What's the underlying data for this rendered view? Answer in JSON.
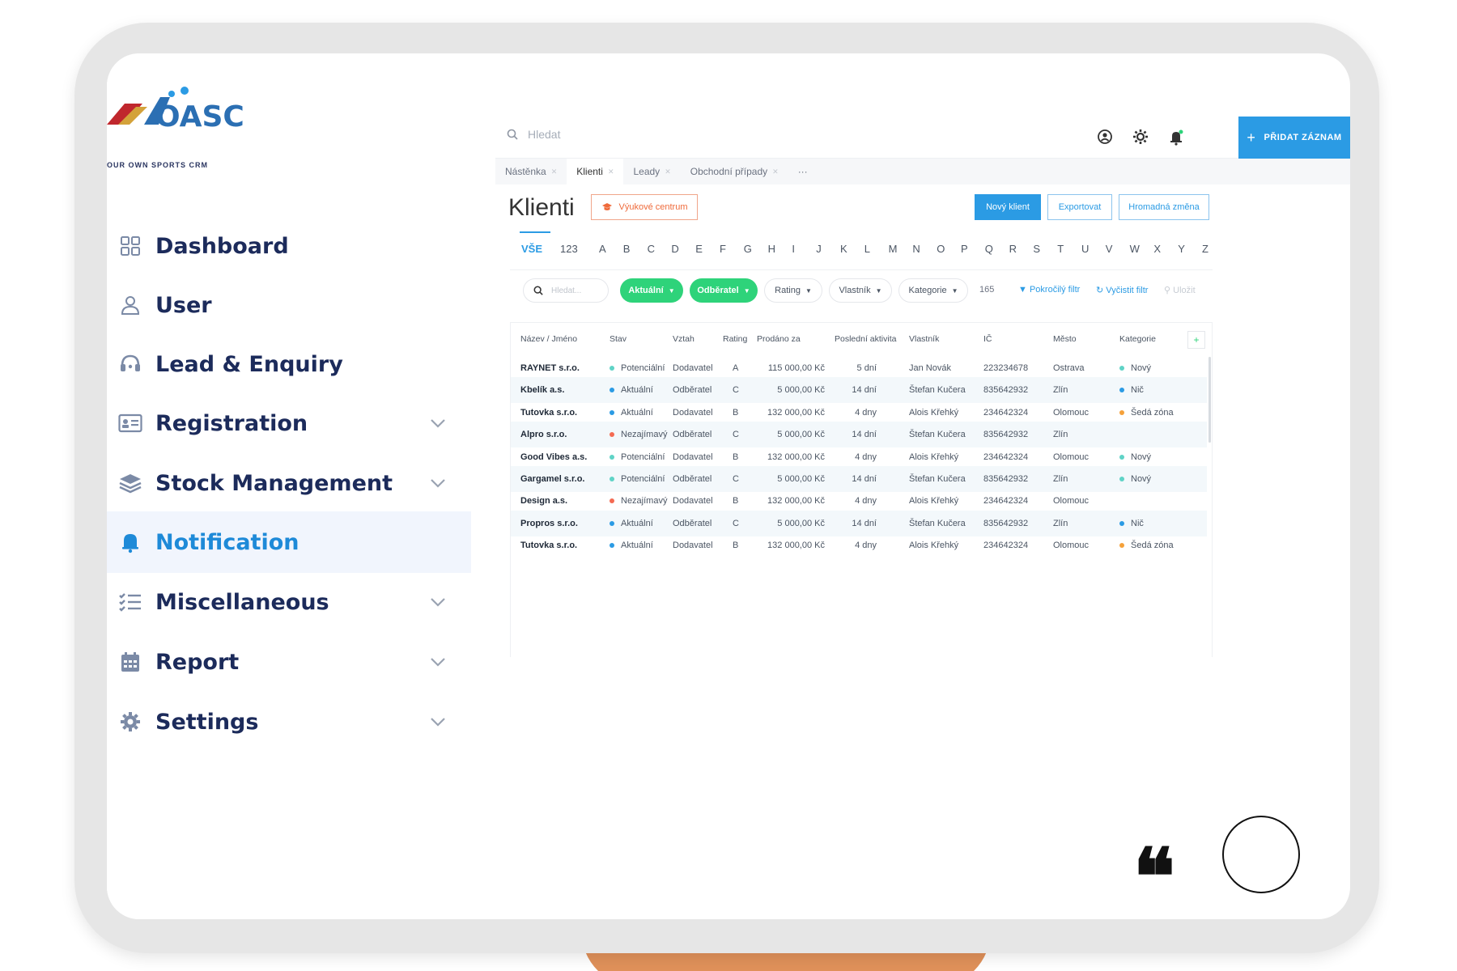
{
  "brand": {
    "logo_text": "OASC",
    "logo_tagline": "OUR OWN SPORTS CRM"
  },
  "sidebar": {
    "items": [
      {
        "label": "Dashboard",
        "icon": "grid-icon",
        "chevron": false,
        "active": false
      },
      {
        "label": "User",
        "icon": "user-icon",
        "chevron": false,
        "active": false
      },
      {
        "label": "Lead & Enquiry",
        "icon": "headset-icon",
        "chevron": false,
        "active": false
      },
      {
        "label": "Registration",
        "icon": "id-card-icon",
        "chevron": true,
        "active": false
      },
      {
        "label": "Stock Management",
        "icon": "layers-icon",
        "chevron": true,
        "active": false
      },
      {
        "label": "Notification",
        "icon": "bell-icon",
        "chevron": false,
        "active": true
      },
      {
        "label": "Miscellaneous",
        "icon": "checklist-icon",
        "chevron": true,
        "active": false
      },
      {
        "label": "Report",
        "icon": "calendar-icon",
        "chevron": true,
        "active": false
      },
      {
        "label": "Settings",
        "icon": "gear-icon",
        "chevron": true,
        "active": false
      }
    ]
  },
  "topbar": {
    "search_placeholder": "Hledat",
    "add_button": "PŘIDAT ZÁZNAM"
  },
  "tabs": [
    {
      "label": "Nástěnka",
      "active": false
    },
    {
      "label": "Klienti",
      "active": true
    },
    {
      "label": "Leady",
      "active": false
    },
    {
      "label": "Obchodní případy",
      "active": false
    }
  ],
  "tabs_more": "···",
  "page": {
    "title": "Klienti",
    "training_button": "Výukové centrum",
    "new_client_button": "Nový klient",
    "export_button": "Exportovat",
    "bulk_button": "Hromadná změna"
  },
  "alphabet": [
    "VŠE",
    "123",
    "A",
    "B",
    "C",
    "D",
    "E",
    "F",
    "G",
    "H",
    "I",
    "J",
    "K",
    "L",
    "M",
    "N",
    "O",
    "P",
    "Q",
    "R",
    "S",
    "T",
    "U",
    "V",
    "W",
    "X",
    "Y",
    "Z"
  ],
  "filters": {
    "search_placeholder": "Hledat...",
    "status_pill": "Aktuální",
    "relation_pill": "Odběratel",
    "rating": "Rating",
    "owner": "Vlastník",
    "category": "Kategorie",
    "count": "165",
    "advanced": "Pokročilý filtr",
    "clear": "Vyčistit filtr",
    "saved": "Uložit"
  },
  "table": {
    "columns": [
      "Název / Jméno",
      "Stav",
      "Vztah",
      "Rating",
      "Prodáno za",
      "Poslední aktivita",
      "Vlastník",
      "IČ",
      "Město",
      "Kategorie"
    ],
    "rows": [
      {
        "name": "RAYNET s.r.o.",
        "status": "Potenciální",
        "status_color": "#5fd3c6",
        "relation": "Dodavatel",
        "rating": "A",
        "sold": "115 000,00 Kč",
        "last": "5 dní",
        "owner": "Jan Novák",
        "ic": "223234678",
        "city": "Ostrava",
        "category": "Nový",
        "cat_color": "#5fd3c6"
      },
      {
        "name": "Kbelík a.s.",
        "status": "Aktuální",
        "status_color": "#2b9be4",
        "relation": "Odběratel",
        "rating": "C",
        "sold": "5 000,00 Kč",
        "last": "14 dní",
        "owner": "Štefan Kučera",
        "ic": "835642932",
        "city": "Zlín",
        "category": "Nič",
        "cat_color": "#2b9be4"
      },
      {
        "name": "Tutovka s.r.o.",
        "status": "Aktuální",
        "status_color": "#2b9be4",
        "relation": "Dodavatel",
        "rating": "B",
        "sold": "132 000,00 Kč",
        "last": "4 dny",
        "owner": "Alois Křehký",
        "ic": "234642324",
        "city": "Olomouc",
        "category": "Šedá zóna",
        "cat_color": "#f5a13a"
      },
      {
        "name": "Alpro s.r.o.",
        "status": "Nezajímavý",
        "status_color": "#f46a52",
        "relation": "Odběratel",
        "rating": "C",
        "sold": "5 000,00 Kč",
        "last": "14 dní",
        "owner": "Štefan Kučera",
        "ic": "835642932",
        "city": "Zlín",
        "category": "",
        "cat_color": ""
      },
      {
        "name": "Good Vibes a.s.",
        "status": "Potenciální",
        "status_color": "#5fd3c6",
        "relation": "Dodavatel",
        "rating": "B",
        "sold": "132 000,00 Kč",
        "last": "4 dny",
        "owner": "Alois Křehký",
        "ic": "234642324",
        "city": "Olomouc",
        "category": "Nový",
        "cat_color": "#5fd3c6"
      },
      {
        "name": "Gargamel s.r.o.",
        "status": "Potenciální",
        "status_color": "#5fd3c6",
        "relation": "Odběratel",
        "rating": "C",
        "sold": "5 000,00 Kč",
        "last": "14 dní",
        "owner": "Štefan Kučera",
        "ic": "835642932",
        "city": "Zlín",
        "category": "Nový",
        "cat_color": "#5fd3c6"
      },
      {
        "name": "Design a.s.",
        "status": "Nezajímavý",
        "status_color": "#f46a52",
        "relation": "Dodavatel",
        "rating": "B",
        "sold": "132 000,00 Kč",
        "last": "4 dny",
        "owner": "Alois Křehký",
        "ic": "234642324",
        "city": "Olomouc",
        "category": "",
        "cat_color": ""
      },
      {
        "name": "Propros s.r.o.",
        "status": "Aktuální",
        "status_color": "#2b9be4",
        "relation": "Odběratel",
        "rating": "C",
        "sold": "5 000,00 Kč",
        "last": "14 dní",
        "owner": "Štefan Kučera",
        "ic": "835642932",
        "city": "Zlín",
        "category": "Nič",
        "cat_color": "#2b9be4"
      },
      {
        "name": "Tutovka s.r.o.",
        "status": "Aktuální",
        "status_color": "#2b9be4",
        "relation": "Dodavatel",
        "rating": "B",
        "sold": "132 000,00 Kč",
        "last": "4 dny",
        "owner": "Alois Křehký",
        "ic": "234642324",
        "city": "Olomouc",
        "category": "Šedá zóna",
        "cat_color": "#f5a13a"
      }
    ]
  },
  "colors": {
    "accent": "#2b9be4",
    "green": "#2ed37a",
    "sidebar_text": "#1c2b5b",
    "orange": "#ef6a3a"
  }
}
